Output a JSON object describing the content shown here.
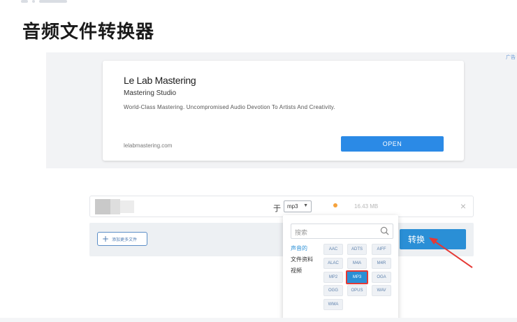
{
  "page": {
    "title": "音频文件转换器"
  },
  "ad": {
    "mark": "广告",
    "brand": "Le Lab Mastering",
    "subtitle": "Mastering Studio",
    "description": "World-Class Mastering. Uncompromised Audio Devotion To Artists And Creativity.",
    "url": "lelabmastering.com",
    "open_label": "OPEN"
  },
  "file": {
    "to_label": "于",
    "format": "mp3",
    "size": "16.43 MB",
    "remove": "×"
  },
  "actions": {
    "add_files_label": "添加更多文件",
    "convert_label": "转换"
  },
  "dropdown": {
    "search_placeholder": "搜索",
    "categories": [
      "声音的",
      "文件资料",
      "视频"
    ],
    "formats": [
      "AAC",
      "ADTS",
      "AIFF",
      "ALAC",
      "M4A",
      "M4R",
      "MP2",
      "MP3",
      "OGA",
      "OGG",
      "OPUS",
      "WAV",
      "WMA"
    ],
    "selected": "MP3"
  },
  "colors": {
    "accent": "#2a8fd6",
    "highlight": "#e53935"
  }
}
